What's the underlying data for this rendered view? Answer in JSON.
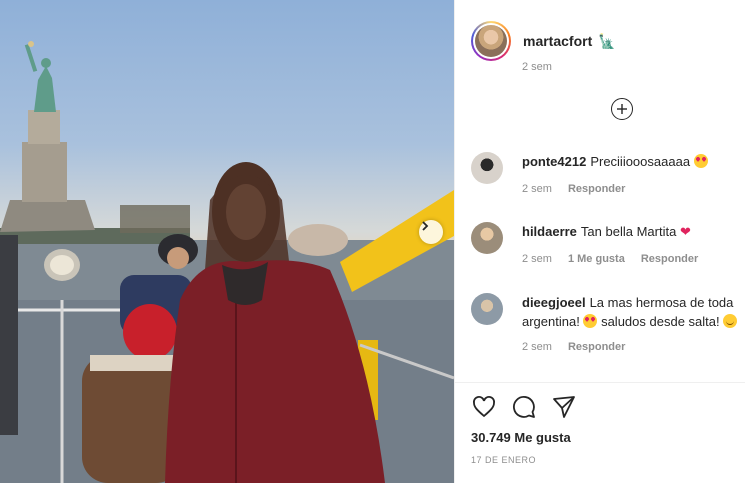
{
  "post": {
    "author": "martacfort",
    "author_emoji": "🗽",
    "caption_time": "2 sem",
    "likes": "30.749 Me gusta",
    "date": "17 DE ENERO"
  },
  "comments": [
    {
      "user": "ponte4212",
      "text": "Preciiiooosaaaaa",
      "emoji": "heart-eyes",
      "time": "2 sem",
      "likes": "",
      "reply": "Responder"
    },
    {
      "user": "hildaerre",
      "text": "Tan bella Martita",
      "emoji": "red-heart",
      "time": "2 sem",
      "likes": "1 Me gusta",
      "reply": "Responder"
    },
    {
      "user": "dieegjoeel",
      "text": "La mas hermosa de toda argentina!",
      "text2": "saludos desde salta!",
      "time": "2 sem",
      "likes": "",
      "reply": "Responder"
    }
  ],
  "icons": {
    "like": "heart-outline-icon",
    "comment": "comment-bubble-icon",
    "share": "paper-plane-icon",
    "load_more": "plus-circle-icon",
    "next": "chevron-right-icon"
  },
  "colors": {
    "text": "#262626",
    "muted": "#8e8e8e",
    "heart": "#e0245e"
  }
}
